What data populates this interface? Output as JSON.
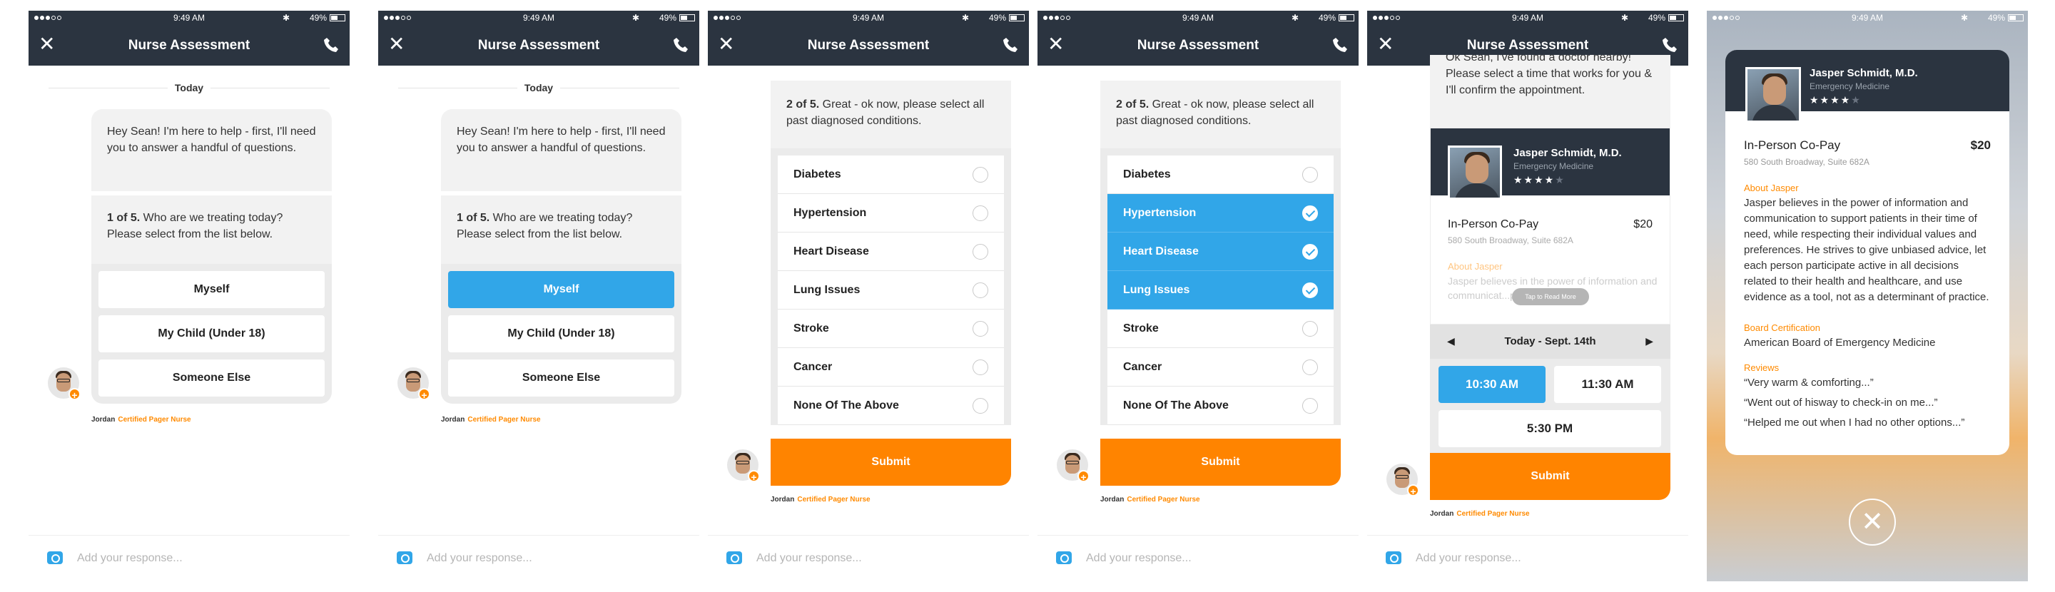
{
  "status": {
    "time": "9:49 AM",
    "battery": "49%"
  },
  "nav": {
    "title": "Nurse Assessment"
  },
  "chat": {
    "today": "Today",
    "greeting": "Hey Sean! I'm here to help - first, I'll need you to answer a handful of questions.",
    "q1": "1 of 5. Who are we treating today? Please select from the list below.",
    "q1_options": [
      "Myself",
      "My Child (Under 18)",
      "Someone Else"
    ],
    "q2": "2 of 5. Great - ok now, please select all past diagnosed conditions.",
    "q2_options": [
      "Diabetes",
      "Hypertension",
      "Heart Disease",
      "Lung Issues",
      "Stroke",
      "Cancer",
      "None Of The Above"
    ],
    "doctor_msg_tail": "Ok Sean, I've found a doctor nearby! Please select a time that works for you & I'll confirm the appointment.",
    "sender_name": "Jordan",
    "sender_role": "Certified Pager Nurse",
    "submit": "Submit",
    "input_placeholder": "Add your response..."
  },
  "doctor": {
    "name": "Jasper Schmidt, M.D.",
    "specialty": "Emergency Medicine",
    "rating": 4,
    "copay_label": "In-Person Co-Pay",
    "copay_value": "$20",
    "address": "580 South Broadway, Suite 682A",
    "about_label": "About Jasper",
    "about_short": "Jasper believes in the power of information and communicat...patients in",
    "tap_more": "Tap to Read More",
    "about_full": "Jasper believes in the power of information and communication to support patients in their time of need, while respecting their individual values and preferences. He strives to give unbiased advice, let each person participate active in all decisions related to their health and healthcare, and use evidence as a tool, not as a determinant of practice.",
    "board_label": "Board Certification",
    "board_value": "American Board of Emergency Medicine",
    "reviews_label": "Reviews",
    "reviews": [
      "“Very warm & comforting...”",
      "“Went out of hisway to check-in on me...”",
      "“Helped me out when I had no other options...”"
    ]
  },
  "schedule": {
    "day_label": "Today - Sept. 14th",
    "slots": [
      "10:30 AM",
      "11:30 AM",
      "5:30 PM"
    ]
  },
  "colors": {
    "accent": "#31a6e8",
    "orange": "#ff8400",
    "navbar": "#2b3440"
  }
}
